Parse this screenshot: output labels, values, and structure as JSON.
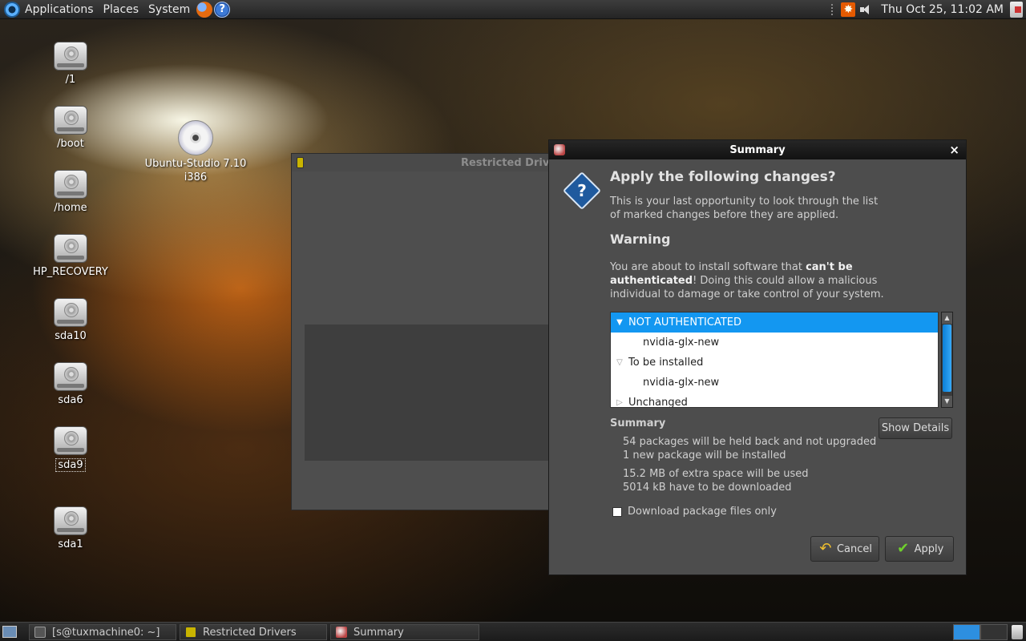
{
  "top_panel": {
    "menus": [
      "Applications",
      "Places",
      "System"
    ],
    "clock": "Thu Oct 25, 11:02 AM"
  },
  "desktop": {
    "drives": [
      "/1",
      "/boot",
      "/home",
      "HP_RECOVERY",
      "sda10",
      "sda6",
      "sda9",
      "sda1"
    ],
    "cd_line1": "Ubuntu-Studio 7.10",
    "cd_line2": "i386"
  },
  "restricted_window": {
    "title": "Restricted Drivers Manager"
  },
  "dialog": {
    "title": "Summary",
    "heading": "Apply the following changes?",
    "intro_line1": "This is your last opportunity to look through the list",
    "intro_line2": "of marked changes before they are applied.",
    "warning_heading": "Warning",
    "warning_part1": "You are about to install software that ",
    "warning_bold1": "can't be",
    "warning_bold2": "authenticated",
    "warning_part2": "! Doing this could allow a malicious",
    "warning_line3": "individual to damage or take control of your system.",
    "tree": [
      {
        "label": "NOT AUTHENTICATED",
        "kind": "group",
        "expanded": true,
        "selected": true
      },
      {
        "label": "nvidia-glx-new",
        "kind": "item"
      },
      {
        "label": "To be installed",
        "kind": "group",
        "expanded": true
      },
      {
        "label": "nvidia-glx-new",
        "kind": "item"
      },
      {
        "label": "Unchanged",
        "kind": "group",
        "expanded": false
      }
    ],
    "summary_label": "Summary",
    "show_details": "Show Details",
    "summary_lines": [
      "54 packages will be held back and not upgraded",
      "1 new package will be installed",
      "15.2 MB of extra space will be used",
      "5014 kB have to be downloaded"
    ],
    "download_only_label": "Download package files only",
    "download_only_checked": false,
    "cancel_label": "Cancel",
    "apply_label": "Apply"
  },
  "taskbar": {
    "tasks": [
      "[s@tuxmachine0: ~]",
      "Restricted Drivers",
      "Summary"
    ]
  },
  "colors": {
    "selection": "#1397f1",
    "dialog_bg": "#4d4d4d"
  }
}
